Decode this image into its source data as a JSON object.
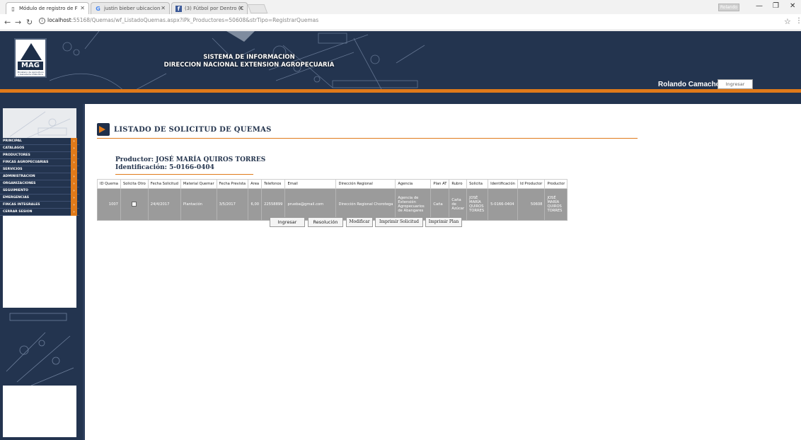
{
  "browser": {
    "tabs": [
      {
        "title": "Módulo de registro de F",
        "icon": "page-icon"
      },
      {
        "title": "justin bieber ubicacion ",
        "icon": "google-icon"
      },
      {
        "title": "(3) Fútbol por Dentro (C",
        "icon": "facebook-icon"
      }
    ],
    "user_chip": "Rolando",
    "url_host": "localhost",
    "url_rest": ":55168/Quemas/wf_ListadoQuemas.aspx?iPk_Productores=50608&strTipo=RegistrarQuemas"
  },
  "header": {
    "logo_text": "MAG",
    "logo_subtext": "Ministerio de Agricultura y Ganadería Costa Rica",
    "system_line1": "SISTEMA DE INFORMACION",
    "system_line2": "DIRECCION NACIONAL EXTENSION AGROPECUARIA",
    "user_name": "Rolando Camacho Rojas",
    "login_button": "Ingresar"
  },
  "sidebar": {
    "items": [
      {
        "label": "PRINCIPAL"
      },
      {
        "label": "CATALAGOS"
      },
      {
        "label": "PRODUCTORES"
      },
      {
        "label": "FINCAS AGROPECUARIAS"
      },
      {
        "label": "SERVICIOS"
      },
      {
        "label": "ADMINISTRACION"
      },
      {
        "label": "ORGANIZACIONES"
      },
      {
        "label": "SEGUIMIENTO"
      },
      {
        "label": "EMERGENCIAS"
      },
      {
        "label": "FINCAS INTEGRALES"
      },
      {
        "label": "CERRAR SESION"
      }
    ]
  },
  "main": {
    "title": "LISTADO DE SOLICITUD DE QUEMAS",
    "producer_line": "Productor: JOSÉ MARÍA QUIROS TORRES",
    "id_line": "Identificación: 5-0166-0404",
    "table": {
      "headers": [
        "ID Quema",
        "Solicita Otro",
        "Fecha Solicitud",
        "Material Quemar",
        "Fecha Prevista",
        "Area",
        "Telefonos",
        "Email",
        "Dirección Regional",
        "Agencia",
        "Plan AT",
        "Rubro",
        "Solicita",
        "Identificación",
        "Id Productor",
        "Productor"
      ],
      "row": {
        "id_quema": "1007",
        "fecha_solicitud": "24/4/2017",
        "material": "Plantación",
        "fecha_prevista": "3/5/2017",
        "area": "6,00",
        "telefonos": "22558899",
        "email": "prueba@gmail.com",
        "direccion": "Dirección Regional Chorotega",
        "agencia": "Agencia de Extensión Agropecuarios de Abangares",
        "plan_at": "Caña",
        "rubro": "Caña de Azúcar",
        "solicita": "JOSÉ MARÍA QUIROS TORRES",
        "identificacion": "5-0166-0404",
        "id_productor": "50608",
        "productor": "JOSÉ MARÍA QUIROS TORRES"
      }
    },
    "buttons": {
      "ingresar": "Ingresar",
      "resolucion": "Resolución",
      "modificar": "Modificar",
      "imprimir_solicitud": "Imprimir Solicitud",
      "imprimir_plan": "Imprimir Plan"
    }
  }
}
